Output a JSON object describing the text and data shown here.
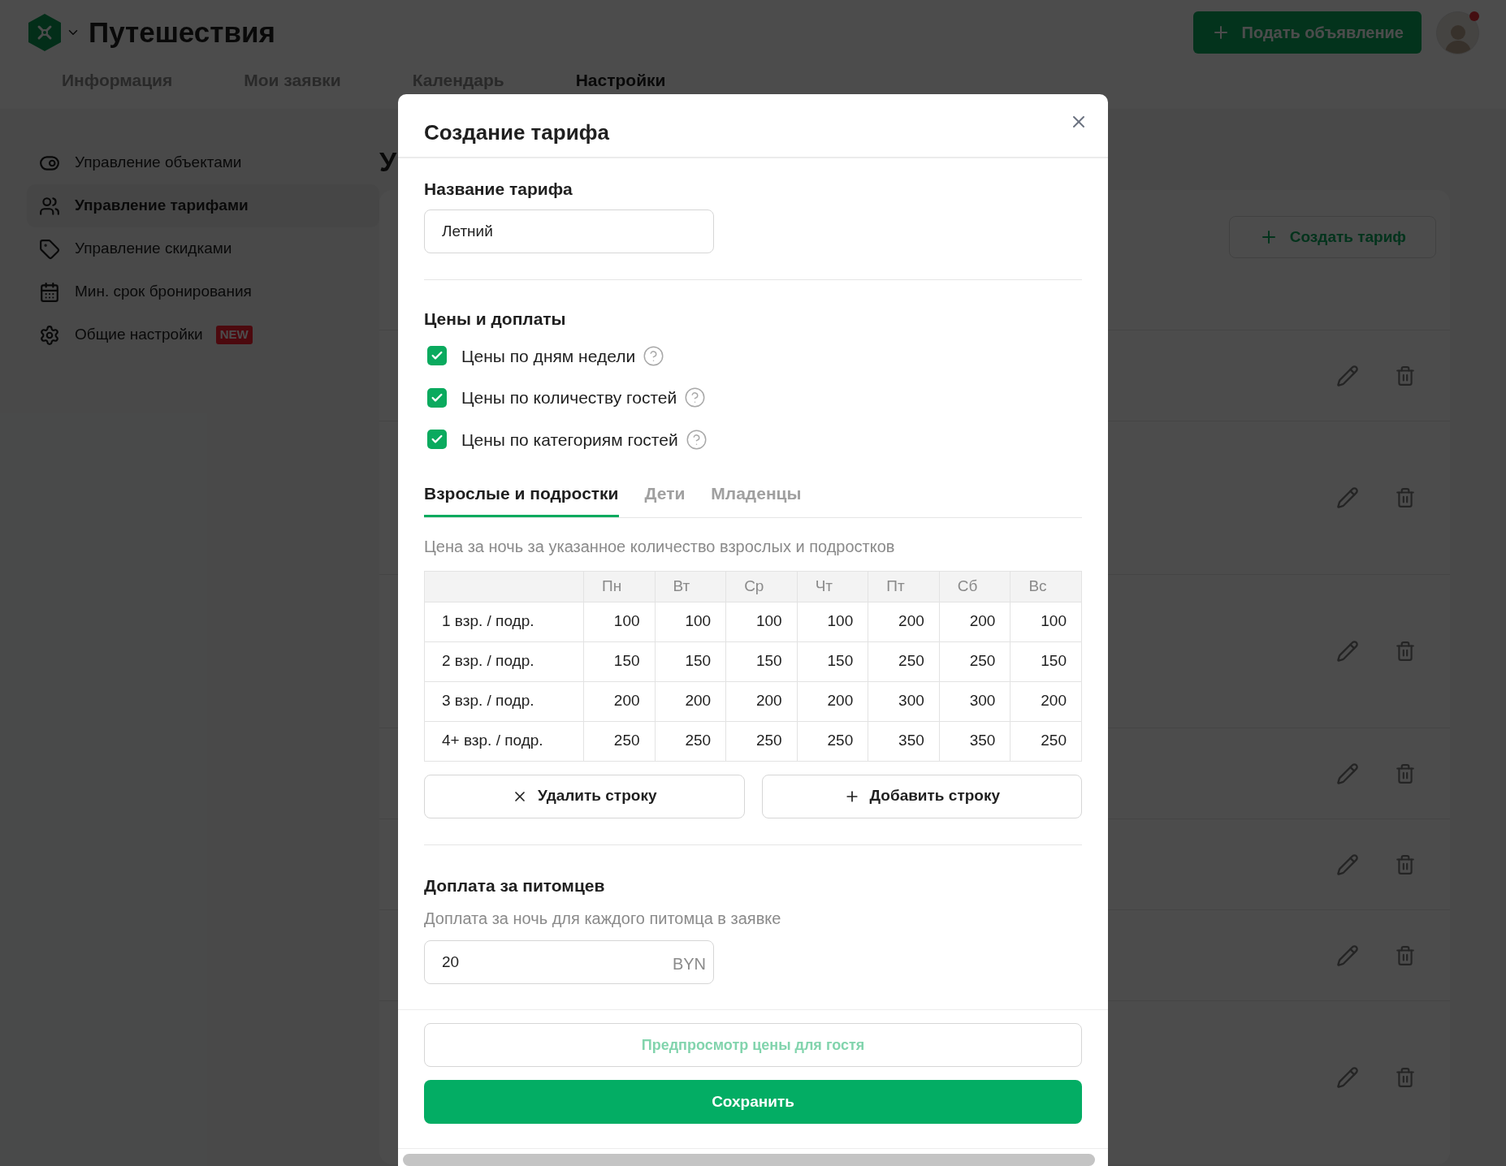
{
  "header": {
    "title": "Путешествия",
    "post_button": "Подать объявление",
    "avatar_notification": true
  },
  "nav_tabs": [
    {
      "label": "Информация",
      "selected": false
    },
    {
      "label": "Мои заявки",
      "selected": false
    },
    {
      "label": "Календарь",
      "selected": false
    },
    {
      "label": "Настройки",
      "selected": true
    }
  ],
  "sidebar": {
    "items": [
      {
        "label": "Управление объектами",
        "selected": false
      },
      {
        "label": "Управление тарифами",
        "selected": true
      },
      {
        "label": "Управление скидками",
        "selected": false
      },
      {
        "label": "Мин. срок бронирования",
        "selected": false
      },
      {
        "label": "Общие настройки",
        "selected": false,
        "badge": "NEW"
      }
    ]
  },
  "page": {
    "heading": "У",
    "create_button": "Создать тариф"
  },
  "modal": {
    "title": "Создание тарифа",
    "name_label": "Название тарифа",
    "name_value": "Летний",
    "prices_heading": "Цены и доплаты",
    "options": [
      {
        "label": "Цены по дням недели",
        "checked": true
      },
      {
        "label": "Цены по количеству гостей",
        "checked": true
      },
      {
        "label": "Цены по категориям гостей",
        "checked": true
      }
    ],
    "tabs": [
      {
        "label": "Взрослые и подростки",
        "selected": true
      },
      {
        "label": "Дети",
        "selected": false
      },
      {
        "label": "Младенцы",
        "selected": false
      }
    ],
    "table_caption": "Цена за ночь за указанное количество взрослых и подростков",
    "table": {
      "columns": [
        "Пн",
        "Вт",
        "Ср",
        "Чт",
        "Пт",
        "Сб",
        "Вс"
      ],
      "rows": [
        {
          "label": "1 взр. / подр.",
          "values": [
            "100",
            "100",
            "100",
            "100",
            "200",
            "200",
            "100"
          ]
        },
        {
          "label": "2 взр. / подр.",
          "values": [
            "150",
            "150",
            "150",
            "150",
            "250",
            "250",
            "150"
          ]
        },
        {
          "label": "3 взр. / подр.",
          "values": [
            "200",
            "200",
            "200",
            "200",
            "300",
            "300",
            "200"
          ]
        },
        {
          "label": "4+ взр. / подр.",
          "values": [
            "250",
            "250",
            "250",
            "250",
            "350",
            "350",
            "250"
          ]
        }
      ]
    },
    "delete_row_button": "Удалить строку",
    "add_row_button": "Добавить строку",
    "pets_heading": "Доплата за питомцев",
    "pets_caption": "Доплата за ночь для каждого питомца в заявке",
    "pets_value": "20",
    "pets_currency": "BYN",
    "preview_button": {
      "label": "Предпросмотр цены для гостя",
      "disabled": true
    },
    "save_button": "Сохранить"
  }
}
